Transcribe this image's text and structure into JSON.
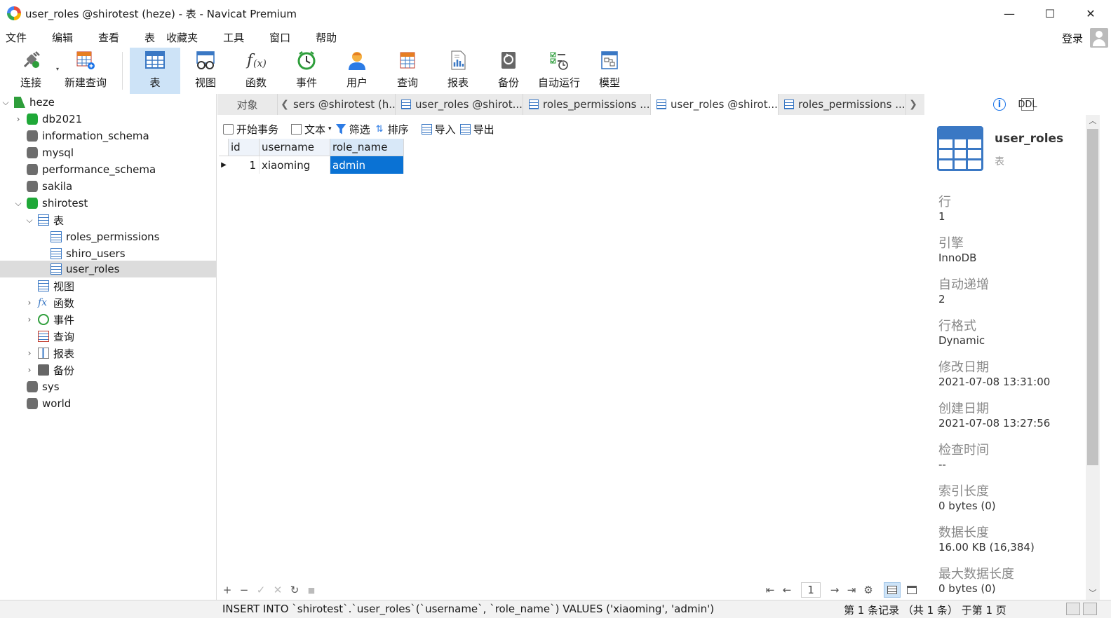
{
  "window": {
    "title": "user_roles @shirotest (heze) - 表 - Navicat Premium",
    "controls": {
      "minimize": "—",
      "maximize": "☐",
      "close": "✕"
    }
  },
  "menu": {
    "items": [
      "文件",
      "编辑",
      "查看",
      "表",
      "收藏夹",
      "工具",
      "窗口",
      "帮助"
    ],
    "login": "登录"
  },
  "toolbar": {
    "items": [
      {
        "label": "连接",
        "icon": "plug-icon"
      },
      {
        "label": "新建查询",
        "icon": "new-query-icon"
      },
      {
        "label": "表",
        "icon": "table-icon"
      },
      {
        "label": "视图",
        "icon": "view-icon"
      },
      {
        "label": "函数",
        "icon": "function-icon"
      },
      {
        "label": "事件",
        "icon": "clock-icon"
      },
      {
        "label": "用户",
        "icon": "user-icon"
      },
      {
        "label": "查询",
        "icon": "query-icon"
      },
      {
        "label": "报表",
        "icon": "report-icon"
      },
      {
        "label": "备份",
        "icon": "backup-icon"
      },
      {
        "label": "自动运行",
        "icon": "automation-icon"
      },
      {
        "label": "模型",
        "icon": "model-icon"
      }
    ]
  },
  "tree": {
    "connection": "heze",
    "items": [
      {
        "label": "db2021"
      },
      {
        "label": "information_schema"
      },
      {
        "label": "mysql"
      },
      {
        "label": "performance_schema"
      },
      {
        "label": "sakila"
      },
      {
        "label": "shirotest"
      },
      {
        "label": "表"
      },
      {
        "label": "roles_permissions"
      },
      {
        "label": "shiro_users"
      },
      {
        "label": "user_roles"
      },
      {
        "label": "视图"
      },
      {
        "label": "函数"
      },
      {
        "label": "事件"
      },
      {
        "label": "查询"
      },
      {
        "label": "报表"
      },
      {
        "label": "备份"
      },
      {
        "label": "sys"
      },
      {
        "label": "world"
      }
    ]
  },
  "tabs": {
    "objects": "对象",
    "items": [
      {
        "label": "sers @shirotest (h..."
      },
      {
        "label": "user_roles @shirot..."
      },
      {
        "label": "roles_permissions ..."
      },
      {
        "label": "user_roles @shirot..."
      },
      {
        "label": "roles_permissions ..."
      }
    ]
  },
  "subtoolbar": {
    "begin_transaction": "开始事务",
    "text": "文本",
    "filter": "筛选",
    "sort": "排序",
    "import": "导入",
    "export": "导出"
  },
  "grid": {
    "columns": [
      "id",
      "username",
      "role_name"
    ],
    "rows": [
      [
        "1",
        "xiaoming",
        "admin"
      ]
    ]
  },
  "gridbar": {
    "add": "+",
    "remove": "−",
    "apply": "✓",
    "discard": "✕",
    "refresh": "↻",
    "stop": "■",
    "page": "1"
  },
  "status": {
    "sql": "INSERT INTO `shirotest`.`user_roles`(`username`, `role_name`) VALUES ('xiaoming', 'admin')",
    "records": "第 1 条记录 （共 1 条） 于第 1 页"
  },
  "info": {
    "name": "user_roles",
    "type": "表",
    "props": [
      {
        "label": "行",
        "value": "1"
      },
      {
        "label": "引擎",
        "value": "InnoDB"
      },
      {
        "label": "自动递增",
        "value": "2"
      },
      {
        "label": "行格式",
        "value": "Dynamic"
      },
      {
        "label": "修改日期",
        "value": "2021-07-08 13:31:00"
      },
      {
        "label": "创建日期",
        "value": "2021-07-08 13:27:56"
      },
      {
        "label": "检查时间",
        "value": "--"
      },
      {
        "label": "索引长度",
        "value": "0 bytes (0)"
      },
      {
        "label": "数据长度",
        "value": "16.00 KB (16,384)"
      },
      {
        "label": "最大数据长度",
        "value": "0 bytes (0)"
      }
    ]
  },
  "colors": {
    "accent": "#0a72d4",
    "active_tool": "#cde3f7",
    "db_active": "#1fa838",
    "table_blue": "#3a78c4"
  }
}
